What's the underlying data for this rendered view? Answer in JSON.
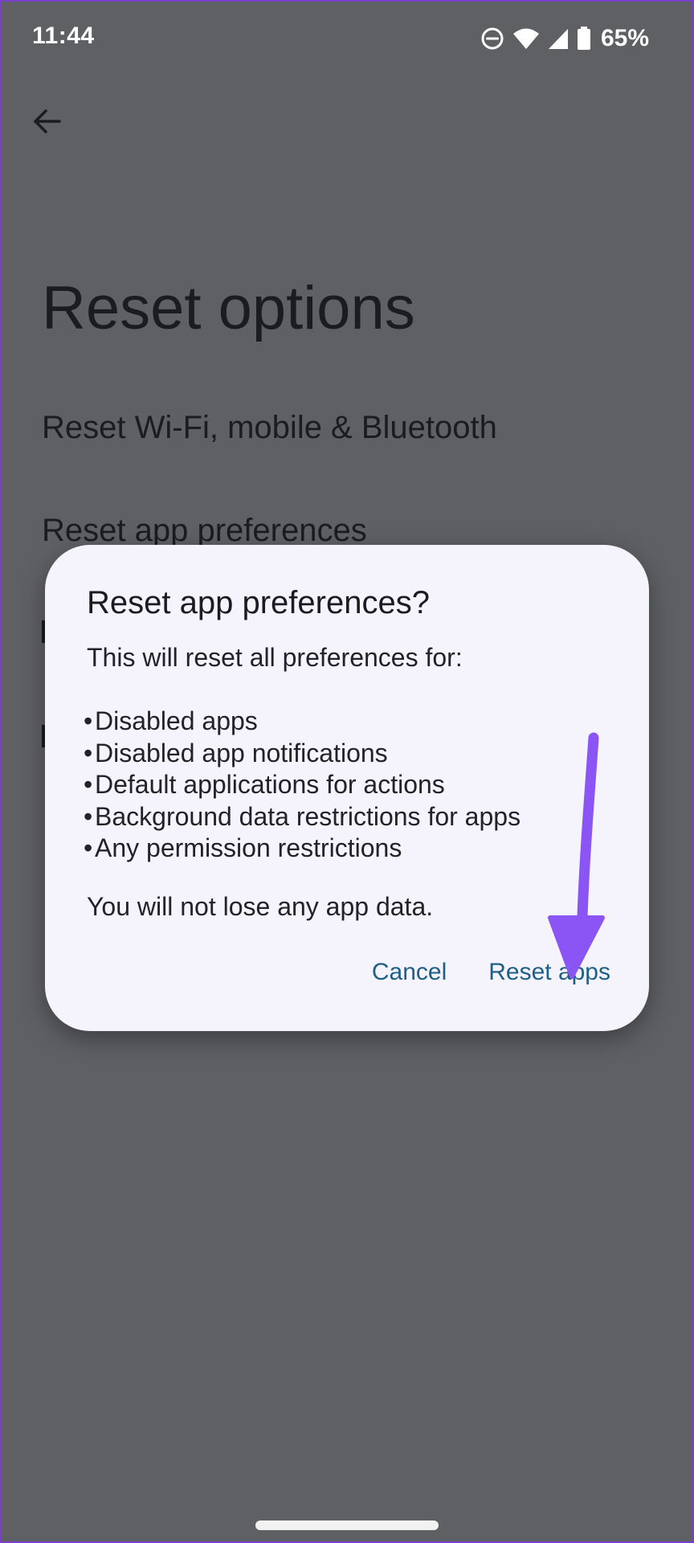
{
  "status_bar": {
    "time": "11:44",
    "battery_percent": "65%",
    "icons": [
      "do-not-disturb-icon",
      "wifi-icon",
      "cellular-signal-icon",
      "battery-icon"
    ]
  },
  "page": {
    "back_icon": "arrow-left-icon",
    "title": "Reset options",
    "items": [
      {
        "label": "Reset Wi-Fi, mobile & Bluetooth"
      },
      {
        "label": "Reset app preferences"
      }
    ]
  },
  "dialog": {
    "title": "Reset app preferences?",
    "intro": "This will reset all preferences for:",
    "list": [
      "Disabled apps",
      "Disabled app notifications",
      "Default applications for actions",
      "Background data restrictions for apps",
      "Any permission restrictions"
    ],
    "note": "You will not lose any app data.",
    "cancel_label": "Cancel",
    "confirm_label": "Reset apps"
  },
  "colors": {
    "scrim_background": "#5f6064",
    "dialog_background": "#f5f4fc",
    "button_text": "#1d5f86",
    "annotation_arrow": "#8b55f5",
    "frame_edge": "#7a3fc9"
  }
}
